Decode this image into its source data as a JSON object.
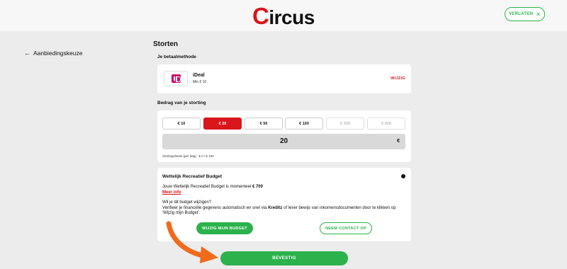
{
  "header": {
    "logo_text": "ircus",
    "logo_initial": "C",
    "leave_label": "VERLATEN",
    "leave_icon": "close-icon"
  },
  "nav": {
    "back_label": "Aanbiedingskeuze",
    "back_icon": "arrow-left-icon"
  },
  "page": {
    "title": "Storten"
  },
  "payment": {
    "section_label": "Je betaalmethode",
    "method_name": "iDeal",
    "method_min": "Min.€ 10",
    "change_label": "WIJZIG"
  },
  "amount": {
    "section_label": "Bedrag van je storting",
    "options": [
      "€ 10",
      "€ 20",
      "€ 50",
      "€ 100",
      "€ 200",
      "€ 500"
    ],
    "selected": "€ 20",
    "value": "20",
    "currency": "€",
    "limit_text": "Stortingslimiet (per dag) : € 0 / € 100"
  },
  "budget": {
    "title": "Wettelijk Recreatief Budget",
    "line_prefix": "Jouw Wettelijk Recreatief Budget is momenteel ",
    "line_amount": "€ 700",
    "more_info": "Meer info",
    "question": "Wil je dit budget wijzigen?",
    "desc_prefix": "Verifieer je financiële gegevens automatisch en snel via ",
    "desc_brand": "Kreditz",
    "desc_suffix": " of lever bewijs van inkomensdocumenten door te klikken op 'Wijzig mijn Budget'.",
    "change_button": "WIJZIG MIJN BUDGET",
    "contact_button": "NEEM CONTACT OP"
  },
  "footer": {
    "confirm_label": "BEVESTIG"
  },
  "colors": {
    "brand_red": "#d9161c",
    "accent_green": "#2bb24c",
    "arrow_orange": "#f26a1b"
  }
}
